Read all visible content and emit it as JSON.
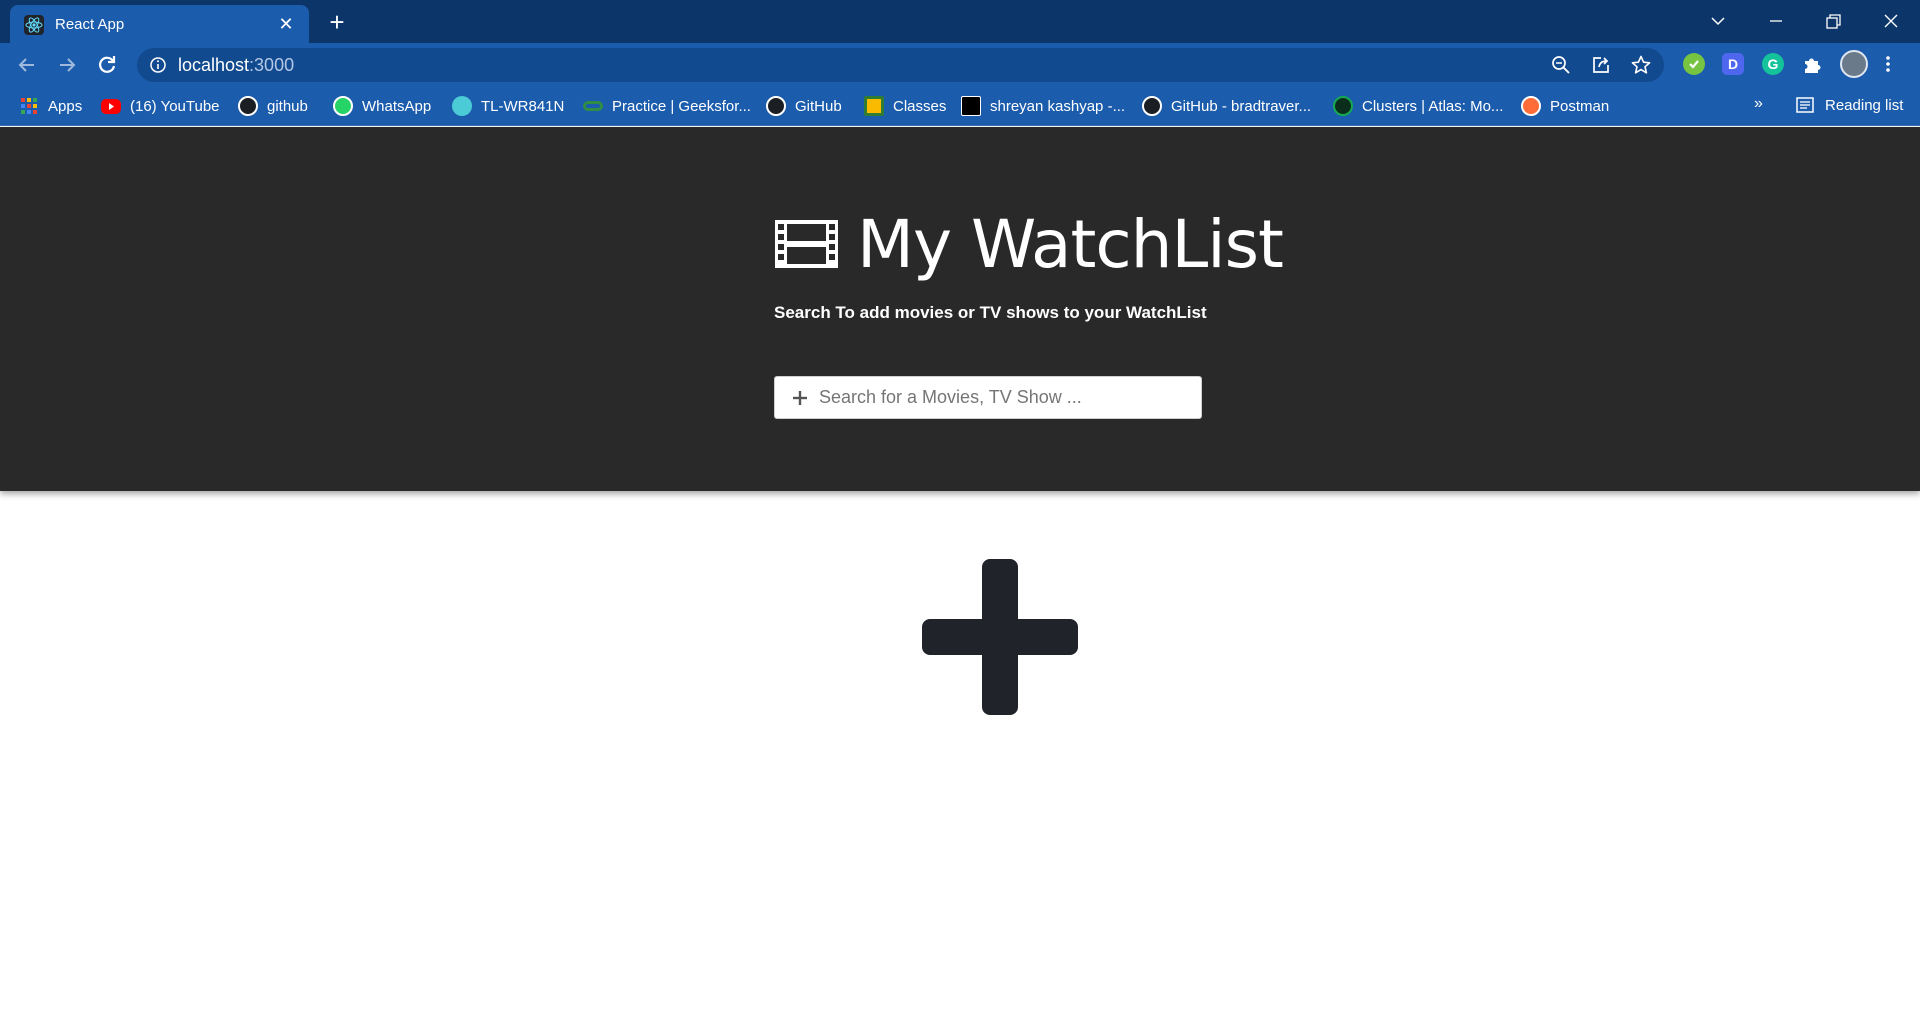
{
  "browser": {
    "tab_title": "React App",
    "url_host": "localhost",
    "url_port": ":3000",
    "bookmarks": [
      {
        "label": "Apps",
        "icon": "apps-grid-icon",
        "color": "#e94235"
      },
      {
        "label": "(16) YouTube",
        "icon": "youtube-icon",
        "color": "#ff0000"
      },
      {
        "label": "github",
        "icon": "github-icon",
        "color": "#1b1f23"
      },
      {
        "label": "WhatsApp",
        "icon": "whatsapp-icon",
        "color": "#25d366"
      },
      {
        "label": "TL-WR841N",
        "icon": "tplink-icon",
        "color": "#4acbd6"
      },
      {
        "label": "Practice | Geeksfor...",
        "icon": "geeksforgeeks-icon",
        "color": "#2f8d46"
      },
      {
        "label": "GitHub",
        "icon": "github-icon",
        "color": "#1b1f23"
      },
      {
        "label": "Classes",
        "icon": "classroom-icon",
        "color": "#f9ba00"
      },
      {
        "label": "shreyan kashyap -...",
        "icon": "hackerrank-icon",
        "color": "#000000"
      },
      {
        "label": "GitHub - bradtraver...",
        "icon": "github-icon",
        "color": "#1b1f23"
      },
      {
        "label": "Clusters | Atlas: Mo...",
        "icon": "mongodb-icon",
        "color": "#13aa52"
      },
      {
        "label": "Postman",
        "icon": "postman-icon",
        "color": "#ff6c37"
      }
    ],
    "overflow_label": "»",
    "reading_list_label": "Reading list"
  },
  "app": {
    "title": "My WatchList",
    "subtitle": "Search To add movies or TV shows to your WatchList",
    "search_placeholder": "Search for a Movies, TV Show ..."
  },
  "colors": {
    "hero_bg": "#292929",
    "chrome_dark": "#0c3669",
    "chrome": "#1c5cac",
    "plus_icon": "#20232a"
  }
}
